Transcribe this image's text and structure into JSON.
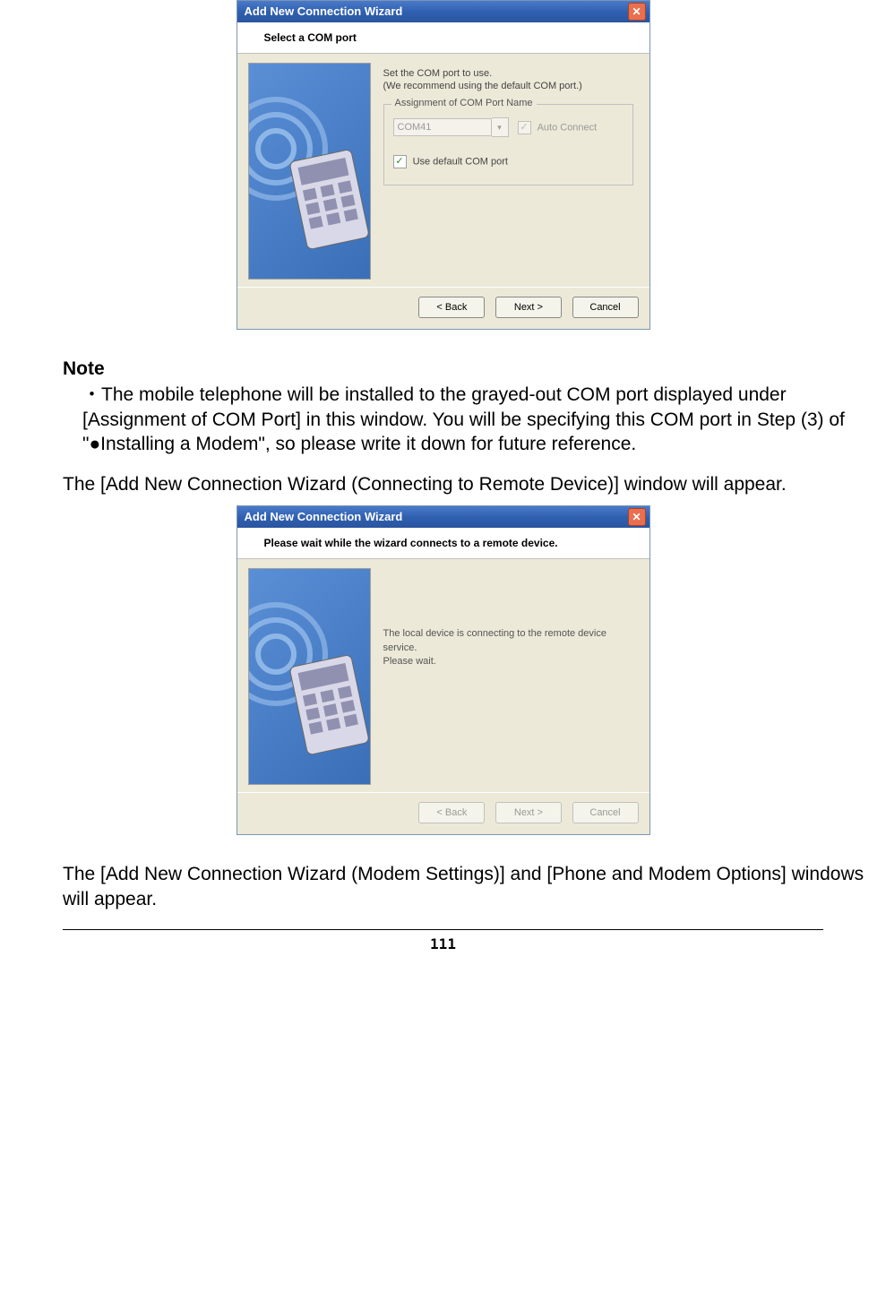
{
  "dialog1": {
    "title": "Add New Connection Wizard",
    "subtitle": "Select a COM port",
    "instr1": "Set the COM port to use.",
    "instr2": "(We recommend using the default COM port.)",
    "legend": "Assignment of COM Port Name",
    "combo_value": "COM41",
    "auto_connect_label": "Auto Connect",
    "use_default_label": "Use default COM port",
    "back": "< Back",
    "next": "Next >",
    "cancel": "Cancel"
  },
  "note": {
    "heading": "Note",
    "body": "・The mobile telephone will be installed to the grayed-out COM port displayed under [Assignment of COM Port] in this window. You will be specifying this COM port in Step (3) of \"●Installing a Modem\", so please write it down for future reference."
  },
  "para1": "The [Add New Connection Wizard (Connecting to Remote Device)] window will appear.",
  "dialog2": {
    "title": "Add New Connection Wizard",
    "subtitle": "Please wait while the wizard connects to a remote device.",
    "status1": "The local device is connecting to the remote device service.",
    "status2": "Please wait.",
    "back": "< Back",
    "next": "Next >",
    "cancel": "Cancel"
  },
  "para2": "The [Add New Connection Wizard (Modem Settings)] and [Phone and Modem Options] windows will appear.",
  "page_number": "111"
}
